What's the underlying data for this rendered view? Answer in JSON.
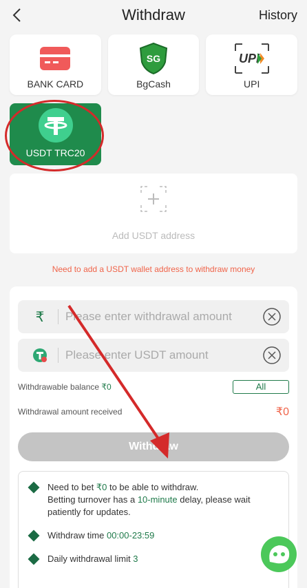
{
  "header": {
    "title": "Withdraw",
    "history": "History"
  },
  "methods": [
    {
      "label": "BANK CARD",
      "icon": "bank-card-icon"
    },
    {
      "label": "BgCash",
      "icon": "bgcash-icon",
      "badge": "SG"
    },
    {
      "label": "UPI",
      "icon": "upi-icon",
      "logo": "UPI"
    }
  ],
  "usdt": {
    "label": "USDT TRC20",
    "icon": "tether-icon"
  },
  "add_address": {
    "label": "Add USDT address"
  },
  "warning": "Need to add a USDT wallet address to withdraw money",
  "form": {
    "amount_placeholder": "Please enter withdrawal amount",
    "amount_symbol": "₹",
    "usdt_placeholder": "Please enter USDT amount",
    "balance_label": "Withdrawable balance",
    "balance_value": "₹0",
    "all_label": "All",
    "received_label": "Withdrawal amount received",
    "received_value": "₹0",
    "withdraw_label": "Withdraw"
  },
  "rules": {
    "r1_a": "Need to bet ",
    "r1_b": "₹0",
    "r1_c": " to be able to withdraw.",
    "r1_d": "Betting turnover has a ",
    "r1_e": "10-minute",
    "r1_f": " delay, please wait patiently for updates.",
    "r2_a": "Withdraw time ",
    "r2_b": "00:00-23:59",
    "r3_a": "Daily withdrawal limit ",
    "r3_b": "3"
  },
  "colors": {
    "accent": "#1f8b4c",
    "warning": "#f0644a",
    "annotation": "#d42a2a"
  }
}
